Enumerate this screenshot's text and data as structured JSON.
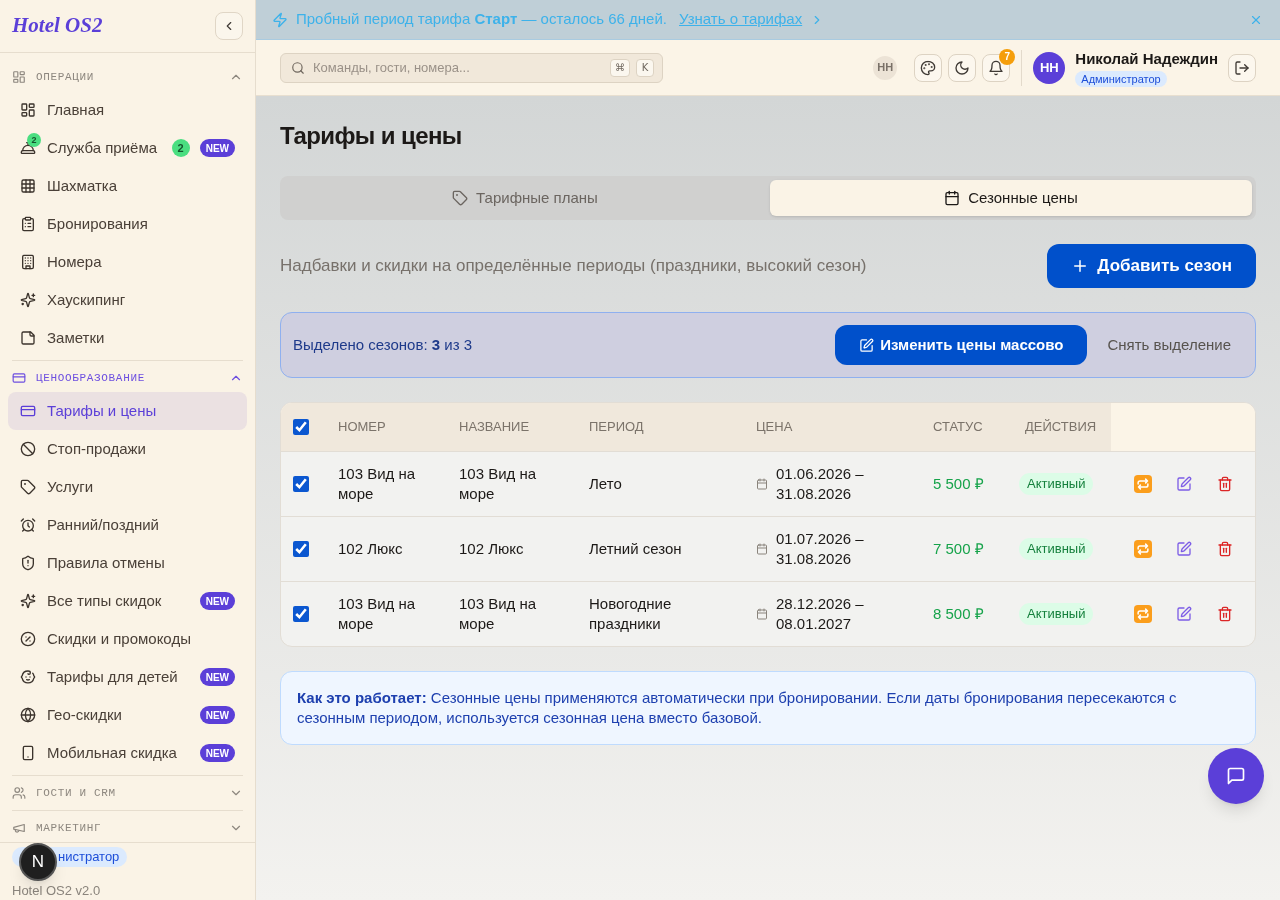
{
  "sidebar": {
    "logo": "Hotel OS2",
    "sections": [
      {
        "title": "ОПЕРАЦИИ",
        "active": false,
        "expanded": true,
        "items": [
          {
            "label": "Главная",
            "selected": false
          },
          {
            "label": "Служба приёма",
            "selected": false,
            "icon_badge": "2",
            "badges": [
              {
                "kind": "count",
                "text": "2"
              },
              {
                "kind": "new",
                "text": "NEW"
              }
            ]
          },
          {
            "label": "Шахматка",
            "selected": false
          },
          {
            "label": "Бронирования",
            "selected": false
          },
          {
            "label": "Номера",
            "selected": false
          },
          {
            "label": "Хаускипинг",
            "selected": false
          },
          {
            "label": "Заметки",
            "selected": false
          }
        ]
      },
      {
        "title": "ЦЕНООБРАЗОВАНИЕ",
        "active": true,
        "expanded": true,
        "items": [
          {
            "label": "Тарифы и цены",
            "selected": true
          },
          {
            "label": "Стоп-продажи",
            "selected": false
          },
          {
            "label": "Услуги",
            "selected": false
          },
          {
            "label": "Ранний/поздний",
            "selected": false
          },
          {
            "label": "Правила отмены",
            "selected": false
          },
          {
            "label": "Все типы скидок",
            "selected": false,
            "badges": [
              {
                "kind": "new",
                "text": "NEW"
              }
            ]
          },
          {
            "label": "Скидки и промокоды",
            "selected": false
          },
          {
            "label": "Тарифы для детей",
            "selected": false,
            "badges": [
              {
                "kind": "new",
                "text": "NEW"
              }
            ]
          },
          {
            "label": "Гео-скидки",
            "selected": false,
            "badges": [
              {
                "kind": "new",
                "text": "NEW"
              }
            ]
          },
          {
            "label": "Мобильная скидка",
            "selected": false,
            "badges": [
              {
                "kind": "new",
                "text": "NEW"
              }
            ]
          }
        ]
      },
      {
        "title": "ГОСТИ И CRM",
        "active": false,
        "expanded": false
      },
      {
        "title": "МАРКЕТИНГ",
        "active": false,
        "expanded": false
      }
    ],
    "footer": {
      "role": "нистратор",
      "version": "Hotel OS2 v2.0"
    }
  },
  "dev_indicator": "N",
  "banner": {
    "text": "Пробный период тарифа **Старт** — осталось 66 дней.",
    "link": "Узнать о тарифах"
  },
  "top_bar": {
    "search_placeholder": "Команды, гости, номера...",
    "shortcut_keys": [
      "⌘",
      "K"
    ],
    "initials_chip": "НН",
    "notification_count": "7",
    "user": {
      "initials": "НН",
      "name": "Николай Надеждин",
      "role": "Администратор"
    }
  },
  "page": {
    "title": "Тарифы и цены",
    "tabs": [
      {
        "label": "Тарифные планы",
        "selected": false
      },
      {
        "label": "Сезонные цены",
        "selected": true
      }
    ],
    "description": "Надбавки и скидки на определённые периоды (праздники, высокий сезон)",
    "add_button": "Добавить сезон",
    "selection_bar": {
      "text": "Выделено сезонов: **3** из 3",
      "bulk_edit_button": "Изменить цены массово",
      "clear_button": "Снять выделение"
    },
    "table": {
      "all_checked": true,
      "columns": [
        "НОМЕР",
        "НАЗВАНИЕ",
        "ПЕРИОД",
        "ЦЕНА",
        "СТАТУС",
        "ДЕЙСТВИЯ"
      ],
      "rows": [
        {
          "checked": true,
          "room": "103 Вид на море",
          "name": "103 Вид на море",
          "period": "Лето",
          "dates": "01.06.2026 – 31.08.2026",
          "price": "5 500 ₽",
          "status": "Активный"
        },
        {
          "checked": true,
          "room": "102 Люкс",
          "name": "102 Люкс",
          "period": "Летний сезон",
          "dates": "01.07.2026 – 31.08.2026",
          "price": "7 500 ₽",
          "status": "Активный"
        },
        {
          "checked": true,
          "room": "103 Вид на море",
          "name": "103 Вид на море",
          "period": "Новогодние праздники",
          "dates": "28.12.2026 – 08.01.2027",
          "price": "8 500 ₽",
          "status": "Активный"
        }
      ]
    },
    "info": "**Как это работает:** Сезонные цены применяются автоматически при бронировании. Если даты бронирования пересекаются с сезонным периодом, используется сезонная цена вместо базовой."
  }
}
